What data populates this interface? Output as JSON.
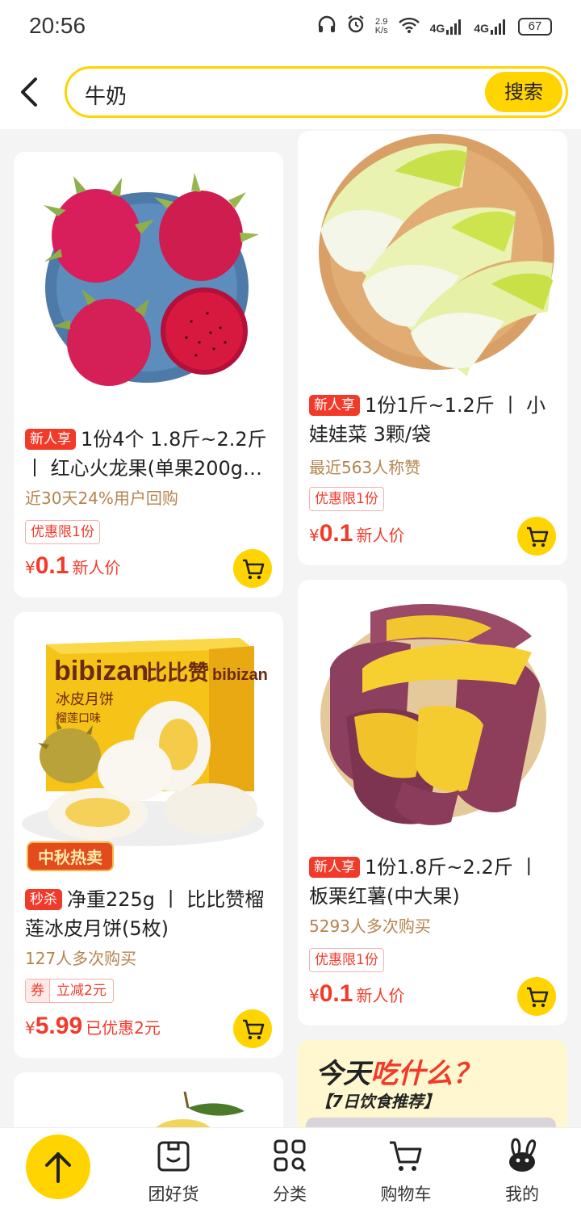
{
  "status_bar": {
    "time": "20:56",
    "net_speed_value": "2.9",
    "net_speed_unit": "K/s",
    "signal_1": "4G",
    "signal_2": "4G",
    "battery": "67"
  },
  "search": {
    "query": "牛奶",
    "button_label": "搜索"
  },
  "products": [
    {
      "tag": "新人享",
      "title": "1份4个 1.8斤~2.2斤 丨 红心火龙果(单果200g…",
      "subtitle": "近30天24%用户回购",
      "limit": "优惠限1份",
      "currency": "¥",
      "price": "0.1",
      "price_label": "新人价"
    },
    {
      "tag": "新人享",
      "title": "1份1斤~1.2斤 丨 小娃娃菜 3颗/袋",
      "subtitle": "最近563人称赞",
      "limit": "优惠限1份",
      "currency": "¥",
      "price": "0.1",
      "price_label": "新人价"
    },
    {
      "tag": "秒杀",
      "title": "净重225g 丨 比比赞榴莲冰皮月饼(5枚)",
      "subtitle": "127人多次购买",
      "coupon_tag": "券",
      "coupon_value": "立减2元",
      "currency": "¥",
      "price": "5.99",
      "price_label": "已优惠2元",
      "promo_badge": "中秋热卖",
      "box_brand": "bibizan",
      "box_brand_cn": "比比赞",
      "box_name": "冰皮月饼",
      "box_flavor": "榴莲口味"
    },
    {
      "tag": "新人享",
      "title": "1份1.8斤~2.2斤 丨 板栗红薯(中大果)",
      "subtitle": "5293人多次购买",
      "limit": "优惠限1份",
      "currency": "¥",
      "price": "0.1",
      "price_label": "新人价"
    }
  ],
  "banner": {
    "title_a": "今天",
    "title_b": "吃什么？",
    "subtitle": "【7日饮食推荐】"
  },
  "bottom_nav": [
    {
      "label": "团好货",
      "icon": "box-smile-icon"
    },
    {
      "label": "分类",
      "icon": "grid-search-icon"
    },
    {
      "label": "购物车",
      "icon": "cart-icon"
    },
    {
      "label": "我的",
      "icon": "rabbit-icon"
    }
  ],
  "colors": {
    "accent_yellow": "#ffd400",
    "price_red": "#f23a2a",
    "subtext_brown": "#b3854e"
  }
}
